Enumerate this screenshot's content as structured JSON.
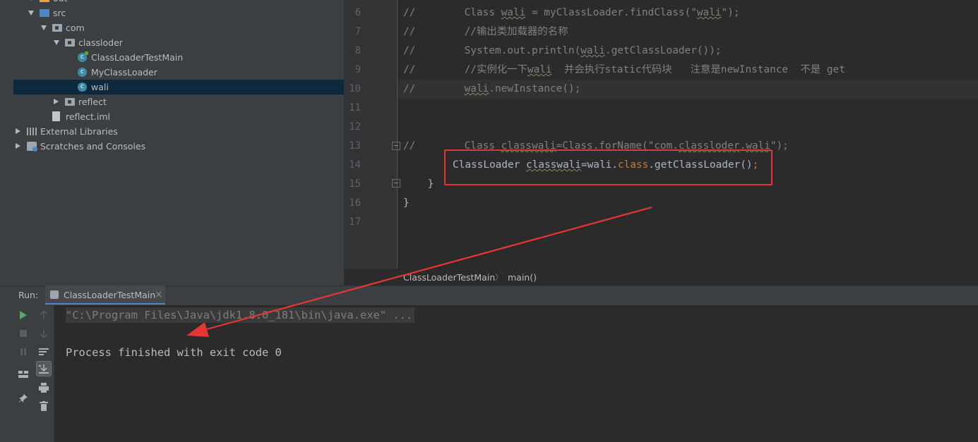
{
  "project_tree": {
    "items": [
      {
        "label": "out",
        "indent": 1,
        "arrow": "down",
        "icon": "folder-orange-icon"
      },
      {
        "label": "src",
        "indent": 1,
        "arrow": "down",
        "icon": "folder-blue-icon"
      },
      {
        "label": "com",
        "indent": 2,
        "arrow": "down",
        "icon": "package-icon"
      },
      {
        "label": "classloder",
        "indent": 3,
        "arrow": "down",
        "icon": "package-icon"
      },
      {
        "label": "ClassLoaderTestMain",
        "indent": 4,
        "arrow": "none",
        "icon": "class-run-icon"
      },
      {
        "label": "MyClassLoader",
        "indent": 4,
        "arrow": "none",
        "icon": "class-icon"
      },
      {
        "label": "wali",
        "indent": 4,
        "arrow": "none",
        "icon": "class-icon",
        "selected": true
      },
      {
        "label": "reflect",
        "indent": 3,
        "arrow": "right",
        "icon": "package-icon"
      },
      {
        "label": "reflect.iml",
        "indent": 2,
        "arrow": "none",
        "icon": "file-icon"
      },
      {
        "label": "External Libraries",
        "indent": 0,
        "arrow": "right",
        "icon": "library-icon"
      },
      {
        "label": "Scratches and Consoles",
        "indent": 0,
        "arrow": "right",
        "icon": "scratches-icon"
      }
    ]
  },
  "editor": {
    "line_numbers": [
      "6",
      "7",
      "8",
      "9",
      "10",
      "11",
      "12",
      "13",
      "14",
      "15",
      "16",
      "17"
    ],
    "lines": {
      "l6": {
        "prefix": "//        Class ",
        "u1": "wali",
        "mid": " = myClassLoader.findClass(\"",
        "u2": "wali",
        "suffix": "\");"
      },
      "l7": {
        "text": "//        //输出类加载器的名称"
      },
      "l8": {
        "prefix": "//        System.out.println(",
        "u1": "wali",
        "suffix": ".getClassLoader());"
      },
      "l9": {
        "prefix": "//        //实例化一下",
        "u1": "wali",
        "suffix": "  并会执行static代码块   注意是newInstance  不是 get"
      },
      "l10": {
        "prefix": "//        ",
        "u1": "wali",
        "suffix": ".newInstance();"
      },
      "l13": {
        "prefix": "//        Class ",
        "u1": "classwali",
        "mid": "=Class.forName(\"com.",
        "u2": "classloder",
        "mid2": ".",
        "u3": "wali",
        "suffix": "\");"
      },
      "l14": {
        "p1": "ClassLoader ",
        "u1": "classwali",
        "p2": "=wali.",
        "kw": "class",
        "p3": ".getClassLoader()",
        "p4": ";"
      },
      "l15": {
        "text": "    }"
      },
      "l16": {
        "text": "}"
      }
    }
  },
  "breadcrumb": {
    "class": "ClassLoaderTestMain",
    "separator": "〉",
    "method": "main()"
  },
  "run_panel": {
    "label": "Run:",
    "tab_label": "ClassLoaderTestMain",
    "close": "×",
    "console": {
      "command": "\"C:\\Program Files\\Java\\jdk1.8.0_181\\bin\\java.exe\" ...",
      "exit": "Process finished with exit code 0"
    }
  },
  "colors": {
    "highlight_box": "#e53535",
    "annotation_arrow": "#e53535",
    "selection": "#0d293e"
  }
}
